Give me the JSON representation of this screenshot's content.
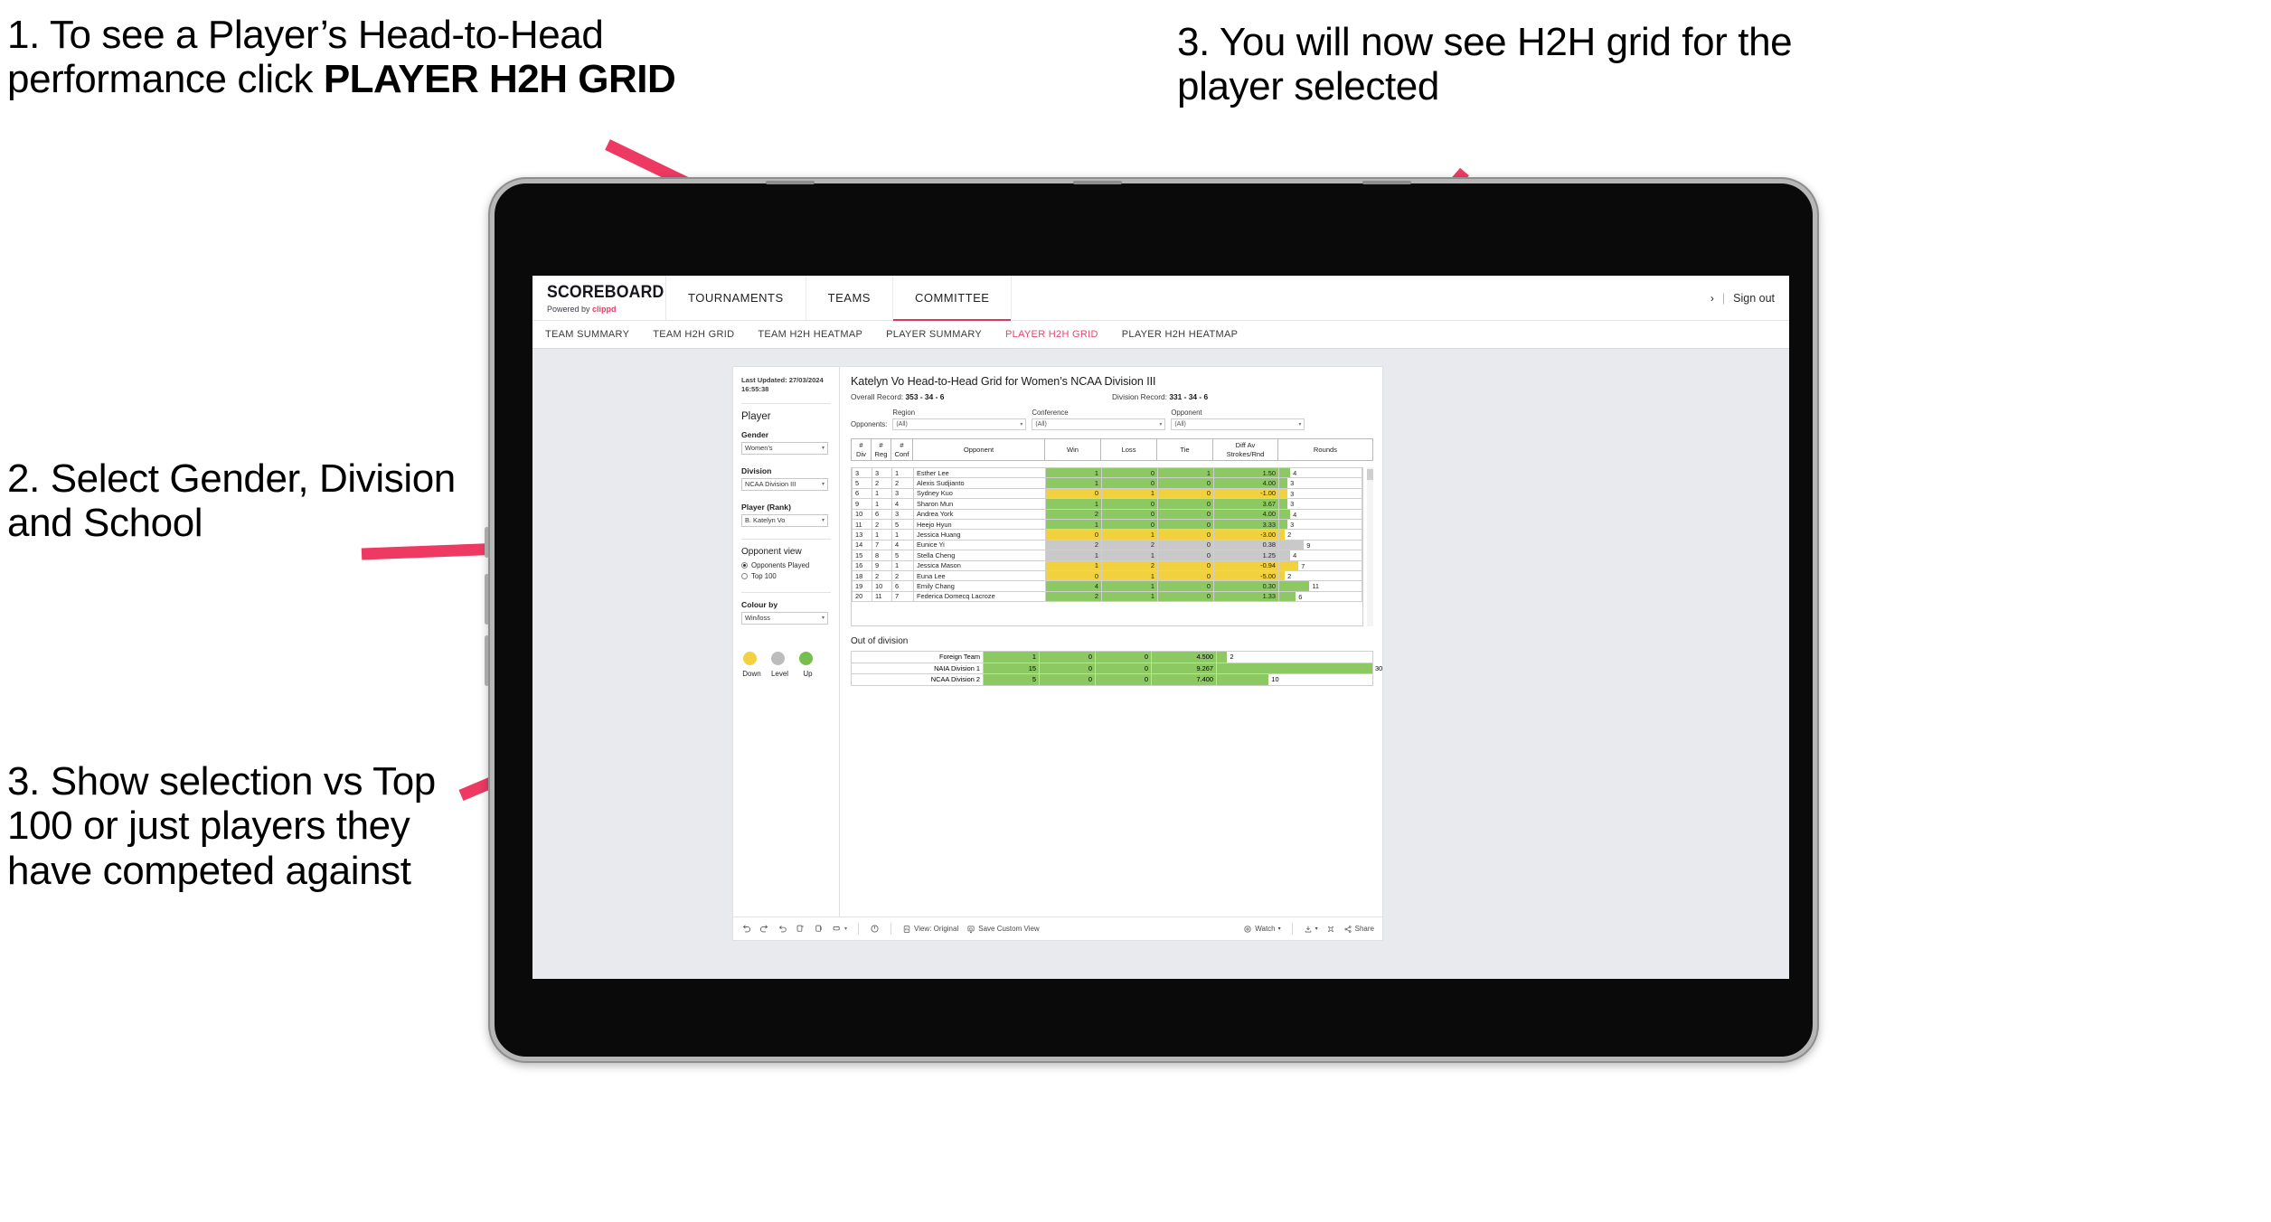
{
  "annotations": [
    {
      "id": "a1",
      "pre": "1. To see a Player’s Head-to-Head performance click ",
      "bold": "PLAYER H2H GRID"
    },
    {
      "id": "a2",
      "text": "2. Select Gender, Division and School"
    },
    {
      "id": "a3",
      "text": "3. Show selection vs Top 100 or just players they have competed against"
    },
    {
      "id": "a4",
      "text": "3. You will now see H2H grid for the player selected"
    }
  ],
  "app": {
    "brand_name": "SCOREBOARD",
    "brand_sub_prefix": "Powered by ",
    "brand_sub_accent": "clippd",
    "top_nav": [
      {
        "label": "TOURNAMENTS",
        "active": false
      },
      {
        "label": "TEAMS",
        "active": false
      },
      {
        "label": "COMMITTEE",
        "active": true
      }
    ],
    "header_right": {
      "chevron": "›",
      "separator": "|",
      "sign_out": "Sign out"
    },
    "sub_nav": [
      {
        "label": "TEAM SUMMARY",
        "active": false
      },
      {
        "label": "TEAM H2H GRID",
        "active": false
      },
      {
        "label": "TEAM H2H HEATMAP",
        "active": false
      },
      {
        "label": "PLAYER SUMMARY",
        "active": false
      },
      {
        "label": "PLAYER H2H GRID",
        "active": true
      },
      {
        "label": "PLAYER H2H HEATMAP",
        "active": false
      }
    ],
    "accent_pink": "#e8446b"
  },
  "filters": {
    "last_updated": "Last Updated: 27/03/2024 16:55:38",
    "section_title": "Player",
    "gender": {
      "label": "Gender",
      "value": "Women’s"
    },
    "division": {
      "label": "Division",
      "value": "NCAA Division III"
    },
    "player": {
      "label": "Player (Rank)",
      "value": "B. Katelyn Vo"
    },
    "opponent_view": {
      "label": "Opponent view",
      "options": [
        {
          "label": "Opponents Played",
          "selected": true
        },
        {
          "label": "Top 100",
          "selected": false
        }
      ]
    },
    "colour_by": {
      "label": "Colour by",
      "value": "Win/loss"
    },
    "legend": [
      {
        "label": "Down",
        "color": "#f2d13f"
      },
      {
        "label": "Level",
        "color": "#bcbcbc"
      },
      {
        "label": "Up",
        "color": "#76bf4e"
      }
    ]
  },
  "viz": {
    "title": "Katelyn Vo Head-to-Head Grid for Women’s NCAA Division III",
    "overall_record_label": "Overall Record:",
    "overall_record_value": "353 -  34 - 6",
    "division_record_label": "Division Record:",
    "division_record_value": "331 -  34 - 6",
    "opponents_label": "Opponents:",
    "opponent_filters": [
      {
        "caption": "Region",
        "value": "(All)"
      },
      {
        "caption": "Conference",
        "value": "(All)"
      },
      {
        "caption": "Opponent",
        "value": "(All)"
      }
    ],
    "columns": [
      "# Div",
      "# Reg",
      "# Conf",
      "Opponent",
      "Win",
      "Loss",
      "Tie",
      "Diff Av Strokes/Rnd",
      "Rounds"
    ],
    "column_lines": [
      [
        "#",
        "Div"
      ],
      [
        "#",
        "Reg"
      ],
      [
        "#",
        "Conf"
      ],
      [
        "Opponent",
        ""
      ],
      [
        "Win",
        ""
      ],
      [
        "Loss",
        ""
      ],
      [
        "Tie",
        ""
      ],
      [
        "Diff Av",
        "Strokes/Rnd"
      ],
      [
        "Rounds",
        ""
      ]
    ],
    "out_of_division_title": "Out of division"
  },
  "toolbar": {
    "view_original": "View: Original",
    "save_custom_view": "Save Custom View",
    "watch": "Watch",
    "share": "Share",
    "caret": "▾"
  },
  "chart_data": {
    "type": "table",
    "title": "Katelyn Vo Head-to-Head Grid for Women’s NCAA Division III",
    "columns": [
      "# Div",
      "# Reg",
      "# Conf",
      "Opponent",
      "Win",
      "Loss",
      "Tie",
      "Diff Av Strokes/Rnd",
      "Rounds"
    ],
    "colour_by": "Win/loss",
    "colour_scale": {
      "up": "#8dc963",
      "level": "#c9c9c9",
      "down": "#f2d13f"
    },
    "rows_max_rounds": 30,
    "rows": [
      {
        "div": "3",
        "reg": "3",
        "conf": "1",
        "opponent": "Esther Lee",
        "win": "1",
        "loss": "0",
        "tie": "1",
        "diff": "1.50",
        "rounds": "4",
        "state": "up"
      },
      {
        "div": "5",
        "reg": "2",
        "conf": "2",
        "opponent": "Alexis Sudjianto",
        "win": "1",
        "loss": "0",
        "tie": "0",
        "diff": "4.00",
        "rounds": "3",
        "state": "up"
      },
      {
        "div": "6",
        "reg": "1",
        "conf": "3",
        "opponent": "Sydney Kuo",
        "win": "0",
        "loss": "1",
        "tie": "0",
        "diff": "-1.00",
        "rounds": "3",
        "state": "down"
      },
      {
        "div": "9",
        "reg": "1",
        "conf": "4",
        "opponent": "Sharon Mun",
        "win": "1",
        "loss": "0",
        "tie": "0",
        "diff": "3.67",
        "rounds": "3",
        "state": "up"
      },
      {
        "div": "10",
        "reg": "6",
        "conf": "3",
        "opponent": "Andrea York",
        "win": "2",
        "loss": "0",
        "tie": "0",
        "diff": "4.00",
        "rounds": "4",
        "state": "up"
      },
      {
        "div": "11",
        "reg": "2",
        "conf": "5",
        "opponent": "Heejo Hyun",
        "win": "1",
        "loss": "0",
        "tie": "0",
        "diff": "3.33",
        "rounds": "3",
        "state": "up"
      },
      {
        "div": "13",
        "reg": "1",
        "conf": "1",
        "opponent": "Jessica Huang",
        "win": "0",
        "loss": "1",
        "tie": "0",
        "diff": "-3.00",
        "rounds": "2",
        "state": "down"
      },
      {
        "div": "14",
        "reg": "7",
        "conf": "4",
        "opponent": "Eunice Yi",
        "win": "2",
        "loss": "2",
        "tie": "0",
        "diff": "0.38",
        "rounds": "9",
        "state": "level"
      },
      {
        "div": "15",
        "reg": "8",
        "conf": "5",
        "opponent": "Stella Cheng",
        "win": "1",
        "loss": "1",
        "tie": "0",
        "diff": "1.25",
        "rounds": "4",
        "state": "level"
      },
      {
        "div": "16",
        "reg": "9",
        "conf": "1",
        "opponent": "Jessica Mason",
        "win": "1",
        "loss": "2",
        "tie": "0",
        "diff": "-0.94",
        "rounds": "7",
        "state": "down"
      },
      {
        "div": "18",
        "reg": "2",
        "conf": "2",
        "opponent": "Euna Lee",
        "win": "0",
        "loss": "1",
        "tie": "0",
        "diff": "-5.00",
        "rounds": "2",
        "state": "down"
      },
      {
        "div": "19",
        "reg": "10",
        "conf": "6",
        "opponent": "Emily Chang",
        "win": "4",
        "loss": "1",
        "tie": "0",
        "diff": "0.30",
        "rounds": "11",
        "state": "up"
      },
      {
        "div": "20",
        "reg": "11",
        "conf": "7",
        "opponent": "Federica Domecq Lacroze",
        "win": "2",
        "loss": "1",
        "tie": "0",
        "diff": "1.33",
        "rounds": "6",
        "state": "up"
      }
    ],
    "out_of_division": [
      {
        "name": "Foreign Team",
        "win": "1",
        "loss": "0",
        "tie": "0",
        "diff": "4.500",
        "rounds": "2",
        "state": "up"
      },
      {
        "name": "NAIA Division 1",
        "win": "15",
        "loss": "0",
        "tie": "0",
        "diff": "9.267",
        "rounds": "30",
        "state": "up"
      },
      {
        "name": "NCAA Division 2",
        "win": "5",
        "loss": "0",
        "tie": "0",
        "diff": "7.400",
        "rounds": "10",
        "state": "up"
      }
    ]
  }
}
